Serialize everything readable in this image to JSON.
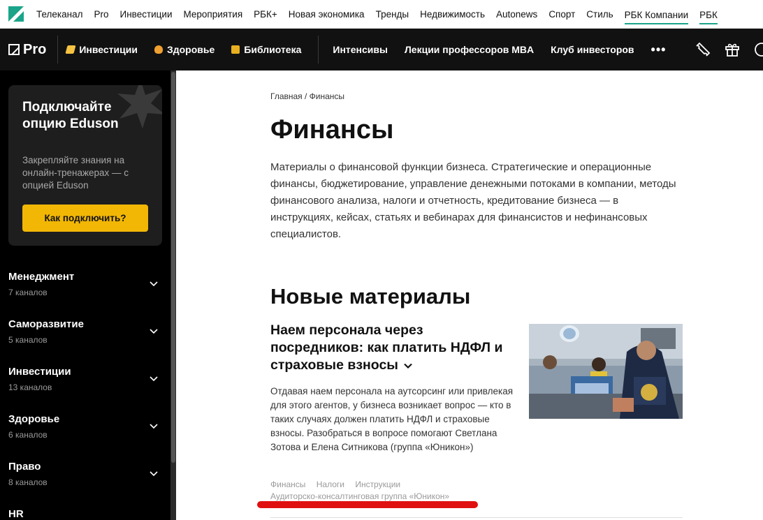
{
  "topbar": {
    "links": [
      "Телеканал",
      "Pro",
      "Инвестиции",
      "Мероприятия",
      "РБК+",
      "Новая экономика",
      "Тренды",
      "Недвижимость",
      "Autonews",
      "Спорт",
      "Стиль",
      "РБК Компании",
      "РБК"
    ]
  },
  "probar": {
    "logo": "Pro",
    "nav": [
      {
        "label": "Инвестиции",
        "emoji_color": "#f5c242"
      },
      {
        "label": "Здоровье",
        "emoji_color": "#f0a030"
      },
      {
        "label": "Библиотека",
        "emoji_color": "#e8b020"
      }
    ],
    "nav2": [
      "Интенсивы",
      "Лекции профессоров MBA",
      "Клуб инвесторов"
    ],
    "more": "•••",
    "icons": [
      "ticket-icon",
      "gift-icon",
      "user-icon"
    ]
  },
  "sidebar": {
    "promo": {
      "title": "Подключайте опцию Eduson",
      "text": "Закрепляйте знания на онлайн-тренажерах — с опцией Eduson",
      "button": "Как подключить?"
    },
    "categories": [
      {
        "title": "Менеджмент",
        "sub": "7 каналов"
      },
      {
        "title": "Саморазвитие",
        "sub": "5 каналов"
      },
      {
        "title": "Инвестиции",
        "sub": "13 каналов"
      },
      {
        "title": "Здоровье",
        "sub": "6 каналов"
      },
      {
        "title": "Право",
        "sub": "8 каналов"
      },
      {
        "title": "HR",
        "sub": ""
      }
    ]
  },
  "main": {
    "breadcrumb": "Главная / Финансы",
    "title": "Финансы",
    "lead": "Материалы о финансовой функции бизнеса. Стратегические и операционные финансы, бюджетирование, управление денежными потоками в компании, методы финансового анализа, налоги и отчетность, кредитование бизнеса — в инструкциях, кейсах, статьях и вебинарах для финансистов и нефинансовых специалистов.",
    "section_title": "Новые материалы",
    "article": {
      "title": "Наем персонала через посредников: как платить НДФЛ и страховые взносы",
      "text": "Отдавая наем персонала на аутсорсинг или привлекая для этого агентов, у бизнеса возникает вопрос — кто в таких случаях должен платить НДФЛ и страховые взносы. Разобраться в вопросе помогают Светлана Зотова и Елена Ситникова (группа «Юникон»)",
      "tags": [
        "Финансы",
        "Налоги",
        "Инструкции"
      ],
      "source": "Аудиторско-консалтинговая группа «Юникон»"
    }
  },
  "colors": {
    "accent_green": "#1aa48a",
    "promo_button": "#f2b705",
    "highlight_red": "#e01010"
  }
}
